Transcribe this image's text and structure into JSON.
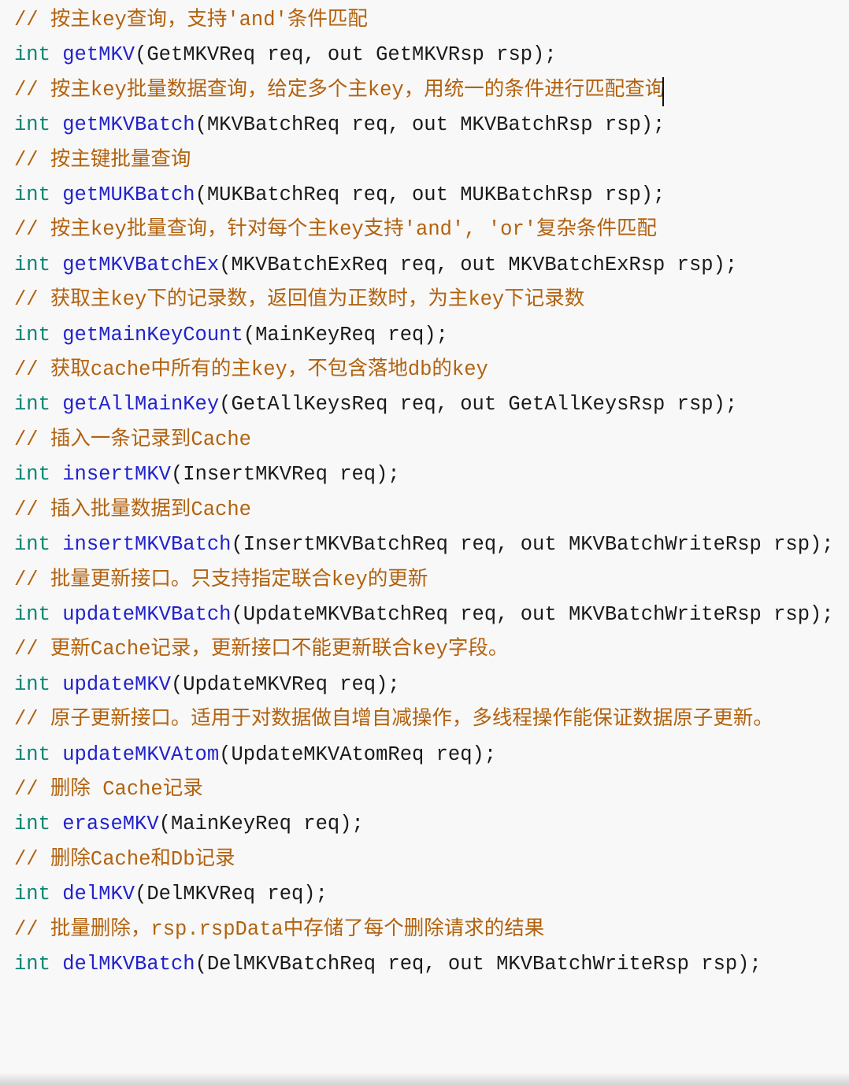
{
  "editor": {
    "language": "tars-idl",
    "background_color": "#f8f8f8",
    "caret_visible": true,
    "colors": {
      "comment": "#b2620f",
      "keyword": "#0a8574",
      "function": "#2222cc",
      "plain": "#1a1a1a",
      "background": "#f8f8f8"
    }
  },
  "code": {
    "lines": [
      {
        "type": "comment",
        "tokens": [
          {
            "cls": "tok-comment",
            "text": "// 按主key查询，支持'and'条件匹配"
          }
        ]
      },
      {
        "type": "declaration",
        "tokens": [
          {
            "cls": "tok-keyword",
            "text": "int"
          },
          {
            "cls": "tok-plain",
            "text": " "
          },
          {
            "cls": "tok-fn",
            "text": "getMKV"
          },
          {
            "cls": "tok-plain",
            "text": "(GetMKVReq req, out GetMKVRsp rsp);"
          }
        ]
      },
      {
        "type": "comment",
        "tokens": [
          {
            "cls": "tok-comment",
            "text": "// 按主key批量数据查询，给定多个主key，用统一的条件进行匹配查询"
          }
        ]
      },
      {
        "type": "declaration",
        "tokens": [
          {
            "cls": "tok-keyword",
            "text": "int"
          },
          {
            "cls": "tok-plain",
            "text": " "
          },
          {
            "cls": "tok-fn",
            "text": "getMKVBatch"
          },
          {
            "cls": "tok-plain",
            "text": "(MKVBatchReq req, out MKVBatchRsp rsp);"
          }
        ]
      },
      {
        "type": "comment",
        "tokens": [
          {
            "cls": "tok-comment",
            "text": "// 按主键批量查询"
          }
        ]
      },
      {
        "type": "declaration",
        "tokens": [
          {
            "cls": "tok-keyword",
            "text": "int"
          },
          {
            "cls": "tok-plain",
            "text": " "
          },
          {
            "cls": "tok-fn",
            "text": "getMUKBatch"
          },
          {
            "cls": "tok-plain",
            "text": "(MUKBatchReq req, out MUKBatchRsp rsp);"
          }
        ]
      },
      {
        "type": "comment",
        "tokens": [
          {
            "cls": "tok-comment",
            "text": "// 按主key批量查询，针对每个主key支持'and', 'or'复杂条件匹配"
          }
        ]
      },
      {
        "type": "declaration",
        "tokens": [
          {
            "cls": "tok-keyword",
            "text": "int"
          },
          {
            "cls": "tok-plain",
            "text": " "
          },
          {
            "cls": "tok-fn",
            "text": "getMKVBatchEx"
          },
          {
            "cls": "tok-plain",
            "text": "(MKVBatchExReq req, out MKVBatchExRsp rsp);"
          }
        ]
      },
      {
        "type": "comment",
        "tokens": [
          {
            "cls": "tok-comment",
            "text": "// 获取主key下的记录数，返回值为正数时，为主key下记录数"
          }
        ]
      },
      {
        "type": "declaration",
        "tokens": [
          {
            "cls": "tok-keyword",
            "text": "int"
          },
          {
            "cls": "tok-plain",
            "text": " "
          },
          {
            "cls": "tok-fn",
            "text": "getMainKeyCount"
          },
          {
            "cls": "tok-plain",
            "text": "(MainKeyReq req);"
          }
        ]
      },
      {
        "type": "comment",
        "tokens": [
          {
            "cls": "tok-comment",
            "text": "// 获取cache中所有的主key，不包含落地db的key"
          }
        ]
      },
      {
        "type": "declaration",
        "tokens": [
          {
            "cls": "tok-keyword",
            "text": "int"
          },
          {
            "cls": "tok-plain",
            "text": " "
          },
          {
            "cls": "tok-fn",
            "text": "getAllMainKey"
          },
          {
            "cls": "tok-plain",
            "text": "(GetAllKeysReq req, out GetAllKeysRsp rsp);"
          }
        ]
      },
      {
        "type": "comment",
        "tokens": [
          {
            "cls": "tok-comment",
            "text": "// 插入一条记录到Cache"
          }
        ]
      },
      {
        "type": "declaration",
        "tokens": [
          {
            "cls": "tok-keyword",
            "text": "int"
          },
          {
            "cls": "tok-plain",
            "text": " "
          },
          {
            "cls": "tok-fn",
            "text": "insertMKV"
          },
          {
            "cls": "tok-plain",
            "text": "(InsertMKVReq req);"
          }
        ]
      },
      {
        "type": "comment",
        "tokens": [
          {
            "cls": "tok-comment",
            "text": "// 插入批量数据到Cache"
          }
        ]
      },
      {
        "type": "declaration",
        "tokens": [
          {
            "cls": "tok-keyword",
            "text": "int"
          },
          {
            "cls": "tok-plain",
            "text": " "
          },
          {
            "cls": "tok-fn",
            "text": "insertMKVBatch"
          },
          {
            "cls": "tok-plain",
            "text": "(InsertMKVBatchReq req, out MKVBatchWriteRsp rsp);"
          }
        ]
      },
      {
        "type": "comment",
        "tokens": [
          {
            "cls": "tok-comment",
            "text": "// 批量更新接口。只支持指定联合key的更新"
          }
        ]
      },
      {
        "type": "declaration",
        "tokens": [
          {
            "cls": "tok-keyword",
            "text": "int"
          },
          {
            "cls": "tok-plain",
            "text": " "
          },
          {
            "cls": "tok-fn",
            "text": "updateMKVBatch"
          },
          {
            "cls": "tok-plain",
            "text": "(UpdateMKVBatchReq req, out MKVBatchWriteRsp rsp);"
          }
        ]
      },
      {
        "type": "comment",
        "tokens": [
          {
            "cls": "tok-comment",
            "text": "// 更新Cache记录，更新接口不能更新联合key字段。"
          }
        ]
      },
      {
        "type": "declaration",
        "tokens": [
          {
            "cls": "tok-keyword",
            "text": "int"
          },
          {
            "cls": "tok-plain",
            "text": " "
          },
          {
            "cls": "tok-fn",
            "text": "updateMKV"
          },
          {
            "cls": "tok-plain",
            "text": "(UpdateMKVReq req);"
          }
        ]
      },
      {
        "type": "comment",
        "tokens": [
          {
            "cls": "tok-comment",
            "text": "// 原子更新接口。适用于对数据做自增自减操作，多线程操作能保证数据原子更新。"
          }
        ]
      },
      {
        "type": "declaration",
        "tokens": [
          {
            "cls": "tok-keyword",
            "text": "int"
          },
          {
            "cls": "tok-plain",
            "text": " "
          },
          {
            "cls": "tok-fn",
            "text": "updateMKVAtom"
          },
          {
            "cls": "tok-plain",
            "text": "(UpdateMKVAtomReq req);"
          }
        ]
      },
      {
        "type": "comment",
        "tokens": [
          {
            "cls": "tok-comment",
            "text": "// 删除 Cache记录"
          }
        ]
      },
      {
        "type": "declaration",
        "tokens": [
          {
            "cls": "tok-keyword",
            "text": "int"
          },
          {
            "cls": "tok-plain",
            "text": " "
          },
          {
            "cls": "tok-fn",
            "text": "eraseMKV"
          },
          {
            "cls": "tok-plain",
            "text": "(MainKeyReq req);"
          }
        ]
      },
      {
        "type": "comment",
        "tokens": [
          {
            "cls": "tok-comment",
            "text": "// 删除Cache和Db记录"
          }
        ]
      },
      {
        "type": "declaration",
        "tokens": [
          {
            "cls": "tok-keyword",
            "text": "int"
          },
          {
            "cls": "tok-plain",
            "text": " "
          },
          {
            "cls": "tok-fn",
            "text": "delMKV"
          },
          {
            "cls": "tok-plain",
            "text": "(DelMKVReq req);"
          }
        ]
      },
      {
        "type": "comment",
        "tokens": [
          {
            "cls": "tok-comment",
            "text": "// 批量删除，rsp.rspData中存储了每个删除请求的结果"
          }
        ]
      },
      {
        "type": "declaration",
        "tokens": [
          {
            "cls": "tok-keyword",
            "text": "int"
          },
          {
            "cls": "tok-plain",
            "text": " "
          },
          {
            "cls": "tok-fn",
            "text": "delMKVBatch"
          },
          {
            "cls": "tok-plain",
            "text": "(DelMKVBatchReq req, out MKVBatchWriteRsp rsp);"
          }
        ]
      }
    ]
  }
}
